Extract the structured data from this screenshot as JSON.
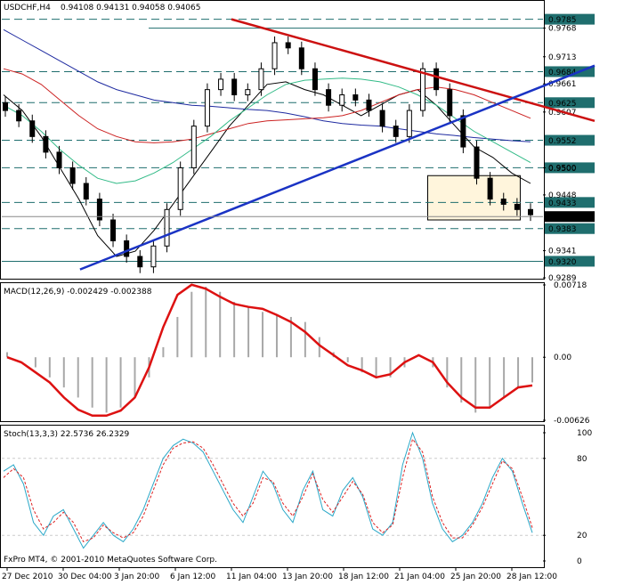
{
  "chart_data": [
    {
      "type": "candlestick",
      "panel": "price",
      "title": "USDCHF,H4",
      "ohlc_text": "0.94108 0.94131 0.94058 0.94065",
      "ylim": [
        0.9289,
        0.9798
      ],
      "y_ticks": [
        0.9289,
        0.9341,
        0.9448,
        0.95,
        0.9607,
        0.9661,
        0.9713,
        0.9768
      ],
      "price_levels": [
        {
          "label": "0.9785",
          "value": 0.9785,
          "style": "dashed",
          "color": "#1f6e6e"
        },
        {
          "label": "0.9684",
          "value": 0.96845,
          "style": "dashed",
          "color": "#1f6e6e"
        },
        {
          "label": "0.9625",
          "value": 0.9625,
          "style": "dashed",
          "color": "#1f6e6e"
        },
        {
          "label": "0.9552",
          "value": 0.95528,
          "style": "dashed",
          "color": "#1f6e6e"
        },
        {
          "label": "0.9500",
          "value": 0.95001,
          "style": "dashed",
          "color": "#1f6e6e"
        },
        {
          "label": "0.9433",
          "value": 0.94336,
          "style": "dashed",
          "color": "#1f6e6e"
        },
        {
          "label": "0.9383",
          "value": 0.93834,
          "style": "dashed",
          "color": "#1f6e6e"
        },
        {
          "label": "0.9320",
          "value": 0.93207,
          "style": "solid",
          "color": "#1f6e6e"
        }
      ],
      "current_price": {
        "label": "0.94065",
        "value": 0.94065
      },
      "extra_level": {
        "value": 0.9768,
        "style": "solid",
        "color": "#1f6e6e"
      },
      "trendlines": [
        {
          "name": "resistance",
          "color": "#cc1111",
          "from": {
            "x": "11 Jan 04:00",
            "y": 0.9785
          },
          "to": {
            "x": "31 Jan 00:00",
            "y": 0.959
          }
        },
        {
          "name": "support",
          "color": "#1a33c4",
          "from": {
            "x": "31 Dec 00:00",
            "y": 0.9305
          },
          "to": {
            "x": "31 Jan 00:00",
            "y": 0.9696
          }
        }
      ],
      "consolidation_box": {
        "x_from": "25 Jan 00:00",
        "x_to": "28 Jan 20:00",
        "y_from": 0.94,
        "y_to": 0.9485,
        "color": "#fff5dc"
      },
      "moving_averages": [
        {
          "color": "#000000",
          "values": [
            0.964,
            0.961,
            0.956,
            0.95,
            0.944,
            0.937,
            0.933,
            0.934,
            0.938,
            0.943,
            0.948,
            0.953,
            0.958,
            0.962,
            0.966,
            0.9665,
            0.965,
            0.964,
            0.962,
            0.96,
            0.962,
            0.964,
            0.965,
            0.962,
            0.958,
            0.954,
            0.952,
            0.949,
            0.947
          ]
        },
        {
          "color": "#1e2aa0",
          "values": [
            0.9765,
            0.9745,
            0.9725,
            0.9705,
            0.9685,
            0.9665,
            0.965,
            0.964,
            0.963,
            0.9625,
            0.962,
            0.9618,
            0.9615,
            0.9612,
            0.961,
            0.9605,
            0.9598,
            0.959,
            0.9585,
            0.9582,
            0.958,
            0.9575,
            0.957,
            0.9565,
            0.9562,
            0.9558,
            0.9555,
            0.9552,
            0.955
          ]
        },
        {
          "color": "#cc2222",
          "values": [
            0.969,
            0.968,
            0.966,
            0.963,
            0.96,
            0.9575,
            0.956,
            0.955,
            0.9548,
            0.955,
            0.9555,
            0.9565,
            0.9575,
            0.9585,
            0.959,
            0.9592,
            0.9594,
            0.9596,
            0.96,
            0.961,
            0.9625,
            0.964,
            0.965,
            0.9655,
            0.965,
            0.964,
            0.9625,
            0.961,
            0.9595
          ]
        },
        {
          "color": "#33bb88",
          "values": [
            0.962,
            0.96,
            0.957,
            0.9535,
            0.9505,
            0.948,
            0.947,
            0.9475,
            0.949,
            0.951,
            0.9535,
            0.956,
            0.959,
            0.9615,
            0.964,
            0.966,
            0.9668,
            0.967,
            0.9672,
            0.967,
            0.9665,
            0.9655,
            0.964,
            0.962,
            0.9595,
            0.957,
            0.955,
            0.953,
            0.951
          ]
        }
      ],
      "candles_close": [
        0.961,
        0.959,
        0.956,
        0.953,
        0.95,
        0.947,
        0.944,
        0.94,
        0.936,
        0.933,
        0.931,
        0.935,
        0.942,
        0.95,
        0.958,
        0.965,
        0.967,
        0.964,
        0.965,
        0.969,
        0.974,
        0.973,
        0.969,
        0.965,
        0.962,
        0.964,
        0.963,
        0.961,
        0.958,
        0.956,
        0.961,
        0.969,
        0.965,
        0.96,
        0.954,
        0.948,
        0.944,
        0.943,
        0.942,
        0.941
      ]
    },
    {
      "type": "histogram+line",
      "panel": "macd",
      "title": "MACD(12,26,9) -0.002429 -0.002388",
      "ylim": [
        -0.00626,
        0.00718
      ],
      "y_ticks_labels": [
        "0.00718",
        "0.00",
        "-0.00626"
      ],
      "y_ticks": [
        0.00718,
        0.0,
        -0.00626
      ],
      "histogram": [
        0.0005,
        0.0,
        -0.001,
        -0.002,
        -0.003,
        -0.004,
        -0.005,
        -0.0055,
        -0.005,
        -0.004,
        -0.002,
        0.001,
        0.004,
        0.0065,
        0.007,
        0.0065,
        0.0055,
        0.005,
        0.0045,
        0.0042,
        0.004,
        0.0035,
        0.002,
        0.0005,
        -0.0005,
        -0.0015,
        -0.002,
        -0.002,
        -0.001,
        0.0,
        -0.001,
        -0.003,
        -0.0045,
        -0.0055,
        -0.005,
        -0.004,
        -0.003,
        -0.0025
      ],
      "signal": [
        0.0,
        -0.0005,
        -0.0015,
        -0.0025,
        -0.004,
        -0.0052,
        -0.0058,
        -0.0058,
        -0.0053,
        -0.004,
        -0.001,
        0.003,
        0.0062,
        0.0072,
        0.0068,
        0.006,
        0.0053,
        0.005,
        0.0048,
        0.0042,
        0.0035,
        0.0025,
        0.0012,
        0.0002,
        -0.0008,
        -0.0013,
        -0.002,
        -0.0017,
        -0.0005,
        0.0002,
        -0.0005,
        -0.0025,
        -0.004,
        -0.005,
        -0.005,
        -0.004,
        -0.003,
        -0.0028
      ]
    },
    {
      "type": "line",
      "panel": "stochastic",
      "title": "Stoch(13,3,3) 22.5736 26.2329",
      "ylim": [
        0,
        100
      ],
      "y_ticks": [
        100,
        80,
        20,
        0
      ],
      "series": [
        {
          "color": "#2aa8c8",
          "values": [
            70,
            75,
            60,
            30,
            20,
            35,
            40,
            25,
            10,
            20,
            30,
            20,
            15,
            25,
            40,
            60,
            80,
            90,
            95,
            92,
            85,
            70,
            55,
            40,
            30,
            50,
            70,
            60,
            40,
            30,
            55,
            70,
            40,
            35,
            55,
            65,
            50,
            25,
            20,
            30,
            75,
            100,
            80,
            45,
            25,
            15,
            20,
            30,
            45,
            65,
            80,
            70,
            45,
            22
          ]
        },
        {
          "color": "#dd2222",
          "values": [
            65,
            72,
            65,
            40,
            25,
            30,
            38,
            30,
            15,
            18,
            28,
            22,
            18,
            22,
            35,
            55,
            75,
            88,
            92,
            93,
            88,
            75,
            60,
            45,
            35,
            45,
            65,
            62,
            45,
            35,
            50,
            68,
            48,
            38,
            50,
            62,
            52,
            30,
            22,
            28,
            65,
            95,
            85,
            50,
            30,
            18,
            18,
            28,
            42,
            60,
            78,
            72,
            50,
            26
          ]
        }
      ]
    }
  ],
  "x_axis_labels": [
    "27 Dec 2010",
    "30 Dec 04:00",
    "3 Jan 20:00",
    "6 Jan 12:00",
    "11 Jan 04:00",
    "13 Jan 20:00",
    "18 Jan 12:00",
    "21 Jan 04:00",
    "25 Jan 20:00",
    "28 Jan 12:00"
  ],
  "footer": "FxPro MT4, © 2001-2010 MetaQuotes Software Corp."
}
